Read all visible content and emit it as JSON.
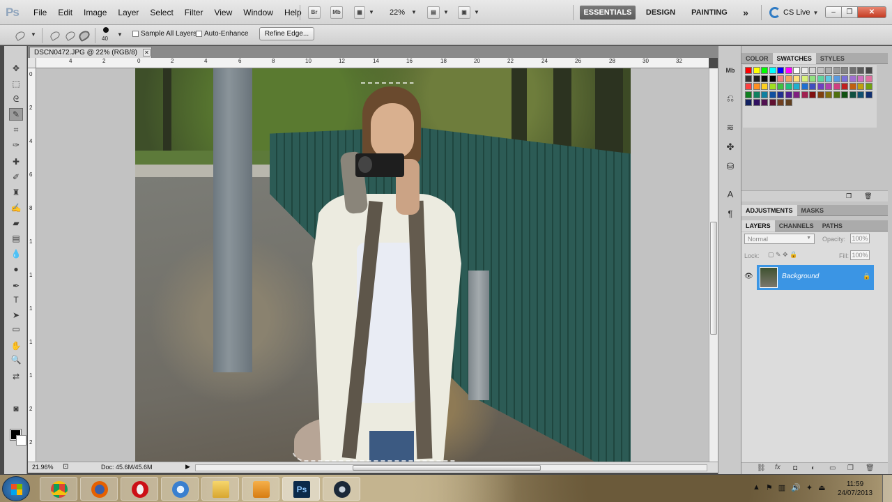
{
  "app": {
    "logo": "Ps"
  },
  "menu": [
    "File",
    "Edit",
    "Image",
    "Layer",
    "Select",
    "Filter",
    "View",
    "Window",
    "Help"
  ],
  "topbar": {
    "bridge": "Br",
    "minibridge": "Mb",
    "zoom": "22%",
    "workspaces": [
      "ESSENTIALS",
      "DESIGN",
      "PAINTING"
    ],
    "more": "»",
    "cslive": "CS Live"
  },
  "options": {
    "brush_size": "40",
    "sample_all_layers": "Sample All Layers",
    "auto_enhance": "Auto-Enhance",
    "refine_edge": "Refine Edge..."
  },
  "document": {
    "tab_title": "DSCN0472.JPG @ 22% (RGB/8)",
    "ruler_top": [
      "4",
      "2",
      "0",
      "2",
      "4",
      "6",
      "8",
      "10",
      "12",
      "14",
      "16",
      "18",
      "20",
      "22",
      "24",
      "26",
      "28",
      "30",
      "32"
    ],
    "ruler_left": [
      "0",
      "2",
      "4",
      "6",
      "8",
      "1",
      "1",
      "1",
      "1",
      "1",
      "2",
      "2"
    ],
    "zoom_status": "21.96%",
    "doc_size": "Doc: 45.6M/45.6M"
  },
  "panels": {
    "top_tabs": [
      "COLOR",
      "SWATCHES",
      "STYLES"
    ],
    "mid_tabs": [
      "ADJUSTMENTS",
      "MASKS"
    ],
    "layer_tabs": [
      "LAYERS",
      "CHANNELS",
      "PATHS"
    ],
    "blend_mode": "Normal",
    "opacity_label": "Opacity:",
    "opacity": "100%",
    "lock_label": "Lock:",
    "fill_label": "Fill:",
    "fill": "100%",
    "layer_name": "Background"
  },
  "swatch_colors": [
    "#ff0000",
    "#ffff00",
    "#00ff00",
    "#00ffff",
    "#0000ff",
    "#ff00ff",
    "#ffffff",
    "#ebebeb",
    "#d6d6d6",
    "#c2c2c2",
    "#adadad",
    "#999999",
    "#858585",
    "#707070",
    "#5c5c5c",
    "#474747",
    "#333333",
    "#1f1f1f",
    "#0a0a0a",
    "#000000",
    "#f08080",
    "#f4a460",
    "#ffe07a",
    "#d8f07a",
    "#90e080",
    "#5fd4a0",
    "#5fc8e0",
    "#5a9ae0",
    "#7a70d8",
    "#a070d0",
    "#d070c0",
    "#e070a0",
    "#ff4040",
    "#ff9020",
    "#ffd020",
    "#a0e020",
    "#40c040",
    "#20c080",
    "#20b0d0",
    "#2070d0",
    "#4050c0",
    "#7040c0",
    "#b040b0",
    "#d04080",
    "#c02020",
    "#c06010",
    "#c0a010",
    "#70a010",
    "#108020",
    "#108060",
    "#1080a0",
    "#1050a0",
    "#203090",
    "#502090",
    "#802080",
    "#a02050",
    "#801010",
    "#804010",
    "#807010",
    "#507010",
    "#105010",
    "#105040",
    "#105070",
    "#103070",
    "#102060",
    "#301060",
    "#501050",
    "#601030",
    "#704020",
    "#604020"
  ],
  "taskbar": {
    "apps": [
      "chrome",
      "firefox",
      "opera",
      "safari",
      "explorer",
      "media",
      "photoshop",
      "steam"
    ],
    "ps_label": "Ps",
    "time": "11:59",
    "date": "24/07/2013"
  }
}
